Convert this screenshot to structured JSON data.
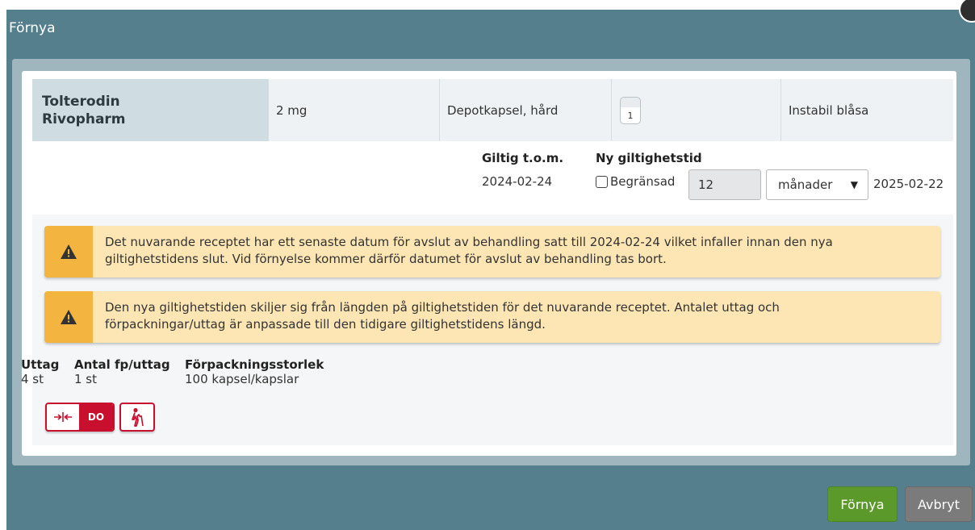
{
  "dialog": {
    "title": "Förnya"
  },
  "drug": {
    "name_line1": "Tolterodin",
    "name_line2": "Rivopharm",
    "strength": "2 mg",
    "form": "Depotkapsel, hård",
    "package_count": "1",
    "reason": "Instabil blåsa"
  },
  "validity": {
    "current_label": "Giltig t.o.m.",
    "current_date": "2024-02-24",
    "new_label": "Ny giltighetstid",
    "limited_label": "Begränsad",
    "limited_checked": false,
    "amount": "12",
    "unit_selected": "månader",
    "new_date": "2025-02-22"
  },
  "warnings": [
    {
      "line1": "Det nuvarande receptet har ett senaste datum för avslut av behandling satt till 2024-02-24 vilket infaller innan den nya",
      "line2": "giltighetstidens slut. Vid förnyelse kommer därför datumet för avslut av behandling tas bort."
    },
    {
      "line1": "Den nya giltighetstiden skiljer sig från längden på giltighetstiden för det nuvarande receptet. Antalet uttag och",
      "line2": "förpackningar/uttag är anpassade till den tidigare giltighetstidens längd."
    }
  ],
  "dispensing": {
    "withdrawals_label": "Uttag",
    "withdrawals_value": "4 st",
    "packs_per_label": "Antal fp/uttag",
    "packs_per_value": "1 st",
    "pack_size_label": "Förpackningsstorlek",
    "pack_size_value": "100 kapsel/kapslar"
  },
  "badges": {
    "do_label": "DO"
  },
  "footer": {
    "renew_label": "Förnya",
    "cancel_label": "Avbryt"
  },
  "colors": {
    "modal_bg": "#557f8c",
    "warning_bg": "#fde6b4",
    "warning_icon_bg": "#f3b540",
    "renew_button": "#5b9a2a",
    "cancel_button": "#7b7b7b",
    "badge_red": "#c8102e"
  }
}
